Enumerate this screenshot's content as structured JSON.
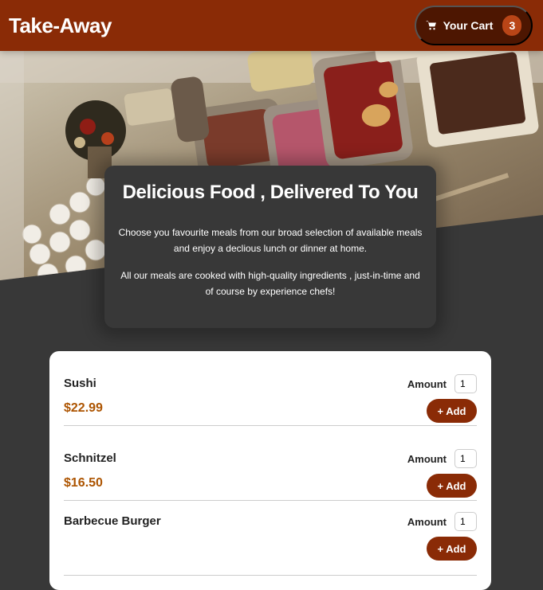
{
  "header": {
    "brand": "Take-Away",
    "cart_label": "Your Cart",
    "cart_count": "3",
    "cart_icon": "shopping-cart-icon"
  },
  "summary": {
    "title": "Delicious Food , Delivered To You",
    "paragraph_1": "Choose you favourite meals from our broad selection of available meals and enjoy a declious lunch or dinner at home.",
    "paragraph_2": "All our meals are cooked with high-quality ingredients , just-in-time and of course by experience chefs!"
  },
  "meals": [
    {
      "name": "Sushi",
      "price": "$22.99",
      "amount_label": "Amount",
      "amount_value": "1",
      "add_label": "+ Add"
    },
    {
      "name": "Schnitzel",
      "price": "$16.50",
      "amount_label": "Amount",
      "amount_value": "1",
      "add_label": "+ Add"
    },
    {
      "name": "Barbecue Burger",
      "price": "",
      "amount_label": "Amount",
      "amount_value": "1",
      "add_label": "+ Add"
    }
  ],
  "colors": {
    "brand": "#8a2b06",
    "cart_bg": "#4d1601",
    "badge": "#b94517",
    "price": "#ad5502",
    "page_bg": "#383838"
  }
}
